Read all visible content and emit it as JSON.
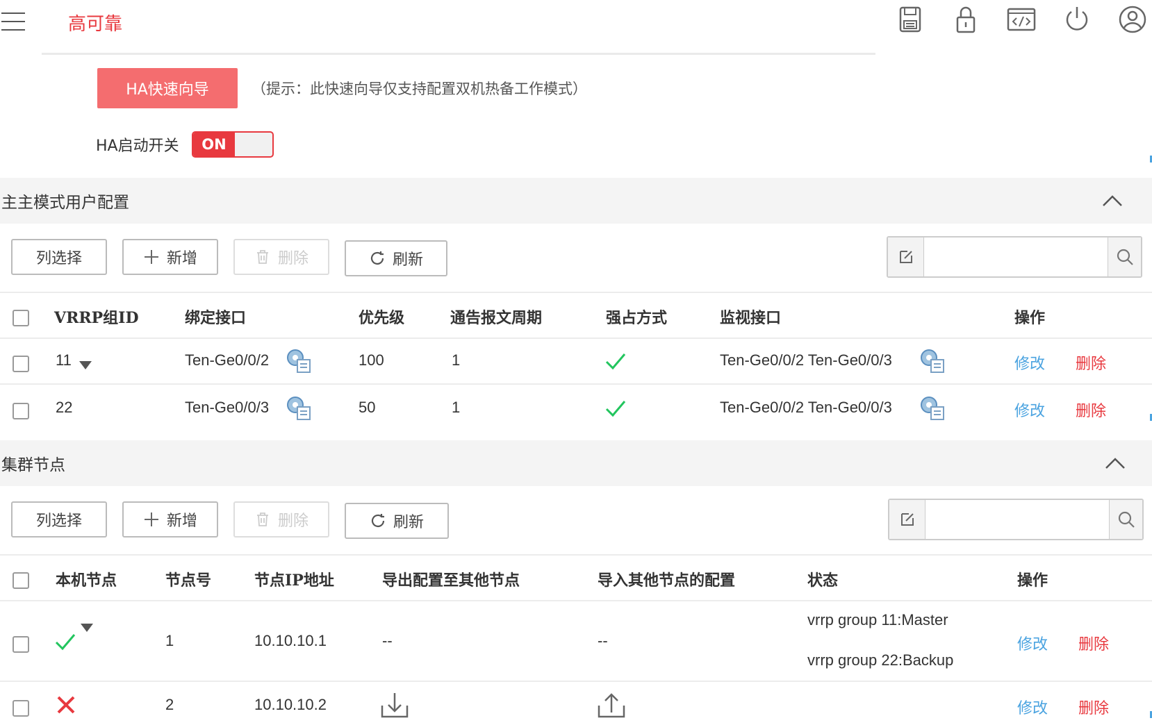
{
  "header": {
    "title": "高可靠"
  },
  "wizard": {
    "button_label": "HA快速向导",
    "hint": "（提示：此快速向导仅支持配置双机热备工作模式）"
  },
  "ha_switch": {
    "label": "HA启动开关",
    "state": "ON"
  },
  "section1": {
    "title": "主主模式用户配置",
    "toolbar": {
      "columns": "列选择",
      "add": "新增",
      "delete": "删除",
      "refresh": "刷新"
    },
    "search_placeholder": "",
    "columns": {
      "vrrp_id": "VRRP组ID",
      "bind_if": "绑定接口",
      "priority": "优先级",
      "period": "通告报文周期",
      "preempt": "强占方式",
      "monitor_if": "监视接口",
      "ops": "操作"
    },
    "rows": [
      {
        "vrrp_id": "11",
        "bind_if": "Ten-Ge0/0/2",
        "priority": "100",
        "period": "1",
        "monitor_if": "Ten-Ge0/0/2 Ten-Ge0/0/3",
        "edit": "修改",
        "delete": "删除"
      },
      {
        "vrrp_id": "22",
        "bind_if": "Ten-Ge0/0/3",
        "priority": "50",
        "period": "1",
        "monitor_if": "Ten-Ge0/0/2 Ten-Ge0/0/3",
        "edit": "修改",
        "delete": "删除"
      }
    ]
  },
  "section2": {
    "title": "集群节点",
    "toolbar": {
      "columns": "列选择",
      "add": "新增",
      "delete": "删除",
      "refresh": "刷新"
    },
    "search_placeholder": "",
    "columns": {
      "local": "本机节点",
      "node_id": "节点号",
      "node_ip": "节点IP地址",
      "export": "导出配置至其他节点",
      "import": "导入其他节点的配置",
      "status": "状态",
      "ops": "操作"
    },
    "rows": [
      {
        "node_id": "1",
        "node_ip": "10.10.10.1",
        "export": "--",
        "import": "--",
        "status1": "vrrp group 11:Master",
        "status2": "vrrp group 22:Backup",
        "edit": "修改",
        "delete": "删除"
      },
      {
        "node_id": "2",
        "node_ip": "10.10.10.2",
        "edit": "修改",
        "delete": "删除"
      }
    ]
  },
  "colors": {
    "accent": "#e8393f",
    "wizard": "#f46d6f",
    "link": "#4aa3e0",
    "check": "#22c55e"
  }
}
